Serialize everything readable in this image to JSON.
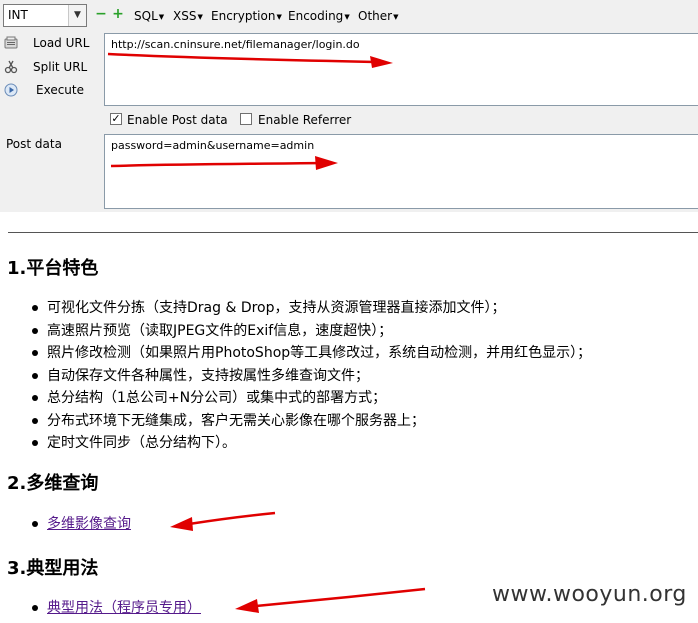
{
  "hackbar": {
    "select_value": "INT",
    "menus": [
      "SQL",
      "XSS",
      "Encryption",
      "Encoding",
      "Other"
    ],
    "buttons": {
      "load_url": "Load URL",
      "split_url": "Split URL",
      "execute": "Execute"
    },
    "url_value": "http://scan.cninsure.net/filemanager/login.do",
    "enable_post": {
      "label": "Enable Post data",
      "checked": true
    },
    "enable_referrer": {
      "label": "Enable Referrer",
      "checked": false
    },
    "post_label": "Post data",
    "post_value": "password=admin&username=admin"
  },
  "content": {
    "section1_title": "1.平台特色",
    "features": [
      "可视化文件分拣（支持Drag & Drop，支持从资源管理器直接添加文件）；",
      "高速照片预览（读取JPEG文件的Exif信息，速度超快）；",
      "照片修改检测（如果照片用PhotoShop等工具修改过，系统自动检测，并用红色显示）；",
      "自动保存文件各种属性，支持按属性多维查询文件；",
      "总分结构（1总公司+N分公司）或集中式的部署方式；",
      "分布式环境下无缝集成，客户无需关心影像在哪个服务器上；",
      "定时文件同步（总分结构下）。"
    ],
    "section2_title": "2.多维查询",
    "section2_link": "多维影像查询",
    "section3_title": "3.典型用法",
    "section3_link": "典型用法（程序员专用）"
  },
  "watermark": "www.wooyun.org",
  "colors": {
    "annotation_arrow": "#e00000",
    "link": "#551a8b",
    "hackbar_bg": "#f0f0f0"
  }
}
